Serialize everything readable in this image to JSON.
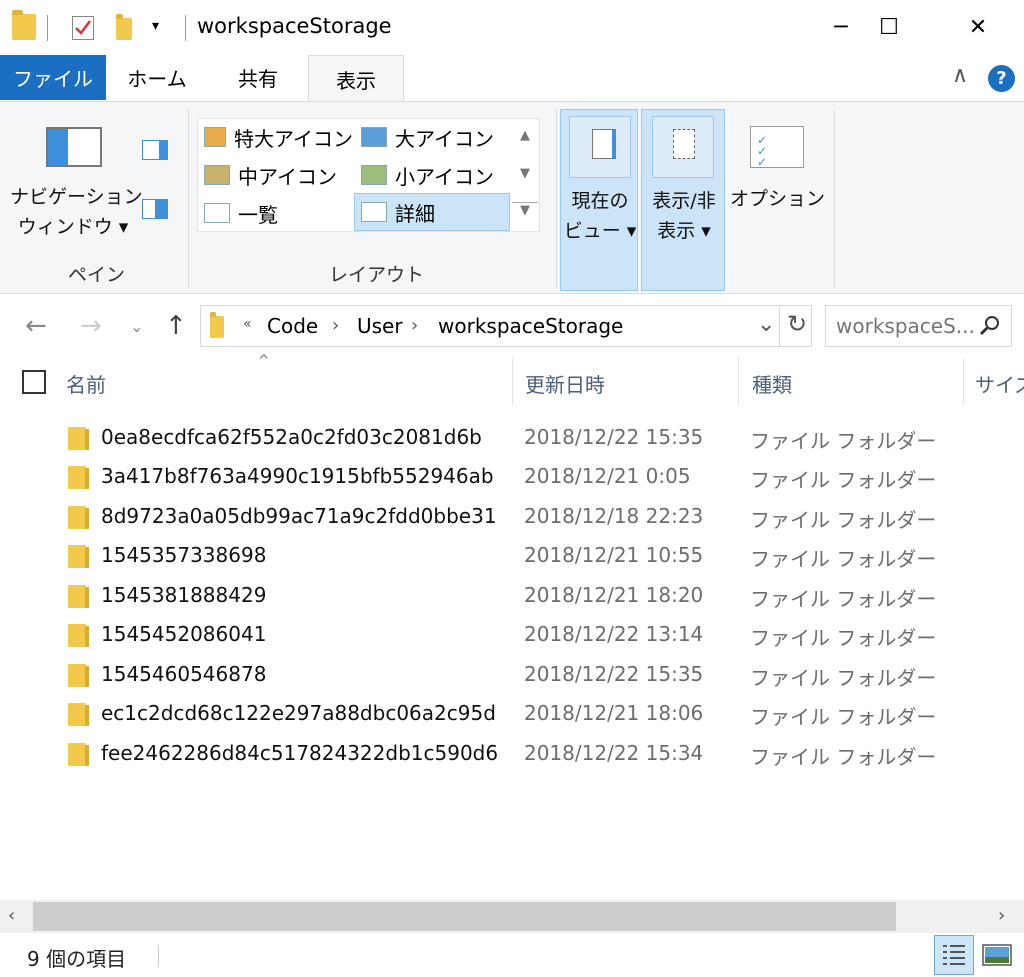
{
  "window": {
    "title": "workspaceStorage",
    "minimize": "─",
    "maximize": "☐",
    "close": "✕"
  },
  "ribbon_tabs": {
    "file": "ファイル",
    "home": "ホーム",
    "share": "共有",
    "view": "表示"
  },
  "ribbon": {
    "pane": {
      "nav_pane_line1": "ナビゲーション",
      "nav_pane_line2": "ウィンドウ ▾",
      "label": "ペイン"
    },
    "layout": {
      "items": [
        "特大アイコン",
        "大アイコン",
        "中アイコン",
        "小アイコン",
        "一覧",
        "詳細"
      ],
      "selected": "詳細",
      "label": "レイアウト"
    },
    "current_view_line1": "現在の",
    "current_view_line2": "ビュー ▾",
    "show_hide_line1": "表示/非",
    "show_hide_line2": "表示 ▾",
    "options": "オプション"
  },
  "address": {
    "overflow": "«",
    "crumbs": [
      "Code",
      "User",
      "workspaceStorage"
    ]
  },
  "search": {
    "placeholder": "workspaceS..."
  },
  "columns": {
    "name": "名前",
    "date": "更新日時",
    "type": "種類",
    "size": "サイズ"
  },
  "files": [
    {
      "name": "0ea8ecdfca62f552a0c2fd03c2081d6b",
      "date": "2018/12/22 15:35",
      "type": "ファイル フォルダー"
    },
    {
      "name": "3a417b8f763a4990c1915bfb552946ab",
      "date": "2018/12/21 0:05",
      "type": "ファイル フォルダー"
    },
    {
      "name": "8d9723a0a05db99ac71a9c2fdd0bbe31",
      "date": "2018/12/18 22:23",
      "type": "ファイル フォルダー"
    },
    {
      "name": "1545357338698",
      "date": "2018/12/21 10:55",
      "type": "ファイル フォルダー"
    },
    {
      "name": "1545381888429",
      "date": "2018/12/21 18:20",
      "type": "ファイル フォルダー"
    },
    {
      "name": "1545452086041",
      "date": "2018/12/22 13:14",
      "type": "ファイル フォルダー"
    },
    {
      "name": "1545460546878",
      "date": "2018/12/22 15:35",
      "type": "ファイル フォルダー"
    },
    {
      "name": "ec1c2dcd68c122e297a88dbc06a2c95d",
      "date": "2018/12/21 18:06",
      "type": "ファイル フォルダー"
    },
    {
      "name": "fee2462286d84c517824322db1c590d6",
      "date": "2018/12/22 15:34",
      "type": "ファイル フォルダー"
    }
  ],
  "status": {
    "item_count": "9 個の項目"
  },
  "colors": {
    "accent": "#1a6fc3",
    "selected_bg": "#cce4f7",
    "folder": "#f2c94c"
  }
}
